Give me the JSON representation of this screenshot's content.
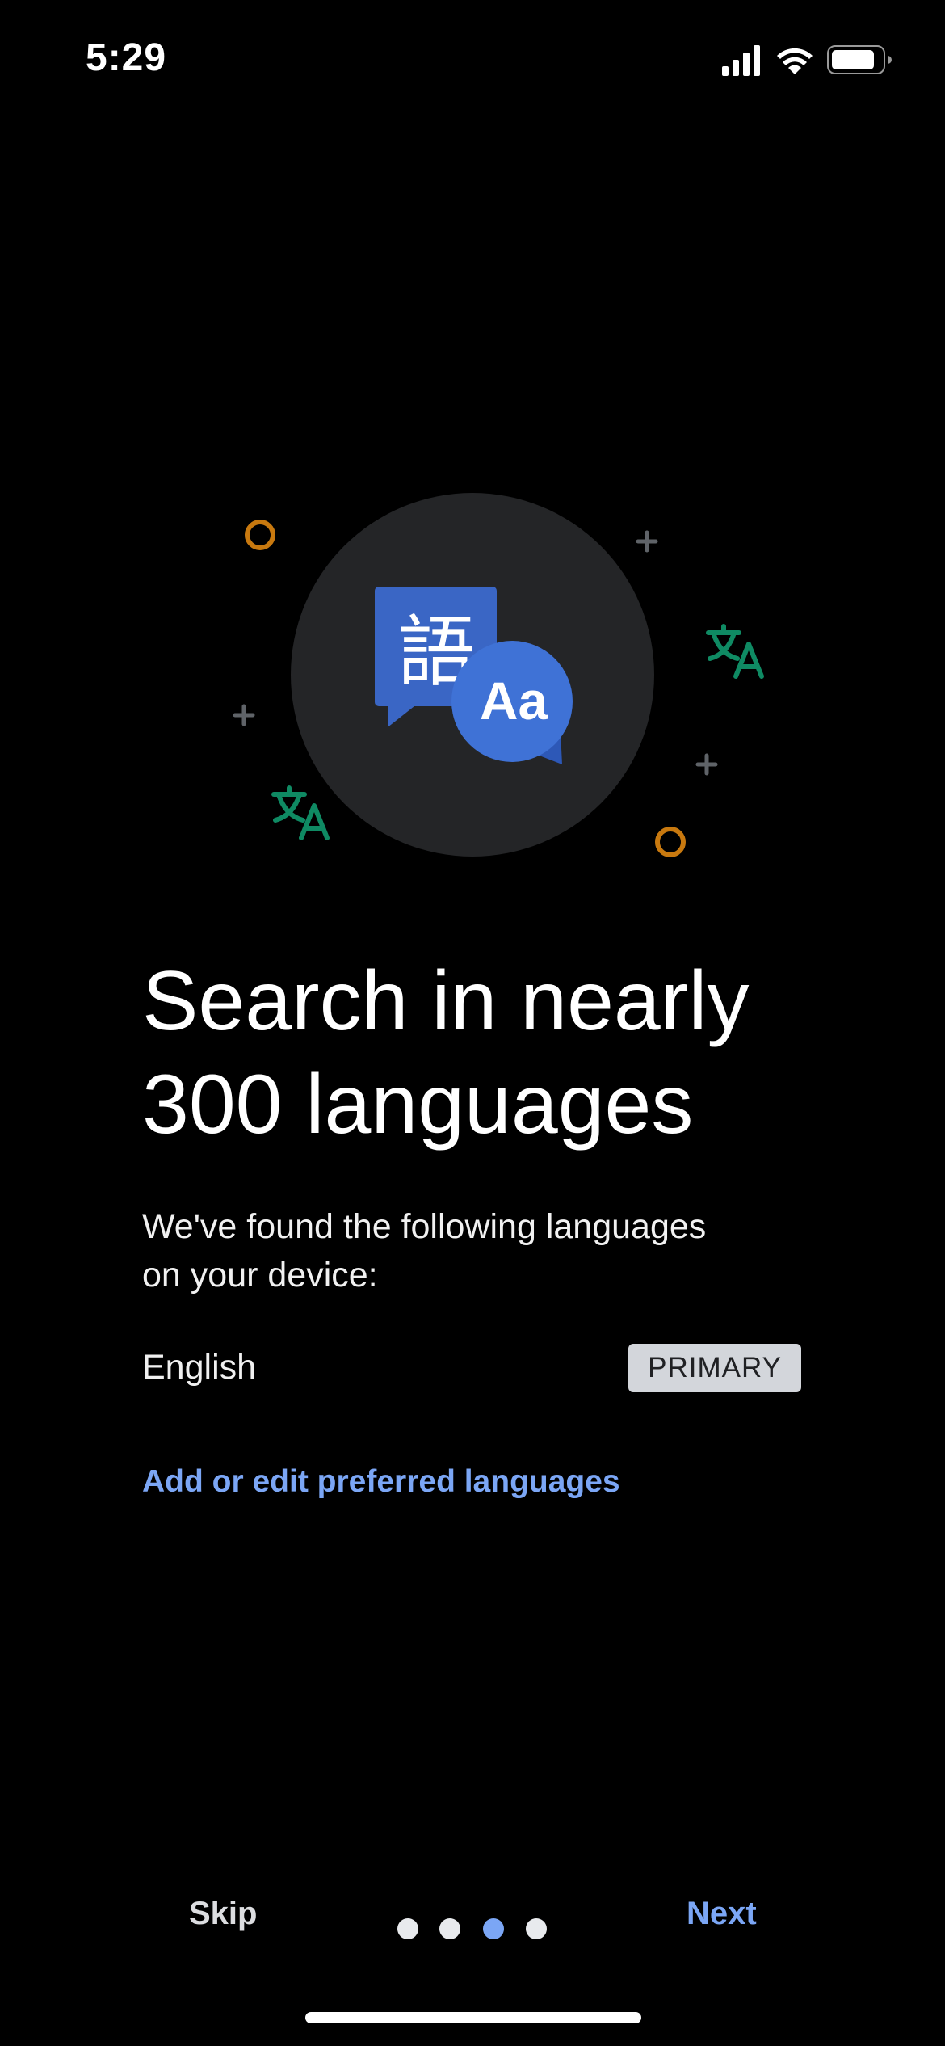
{
  "status_bar": {
    "time": "5:29"
  },
  "illustration": {
    "kanji": "語",
    "latin": "Aa",
    "colors": {
      "circle_bg": "#242527",
      "left_bubble": "#3a66c5",
      "right_bubble": "#3f72d6",
      "orange_ring": "#c8790f",
      "green_translate": "#0f8a63",
      "plus_gray": "#5f6368"
    }
  },
  "content": {
    "headline_line1": "Search in nearly",
    "headline_line2": "300 languages",
    "subtitle_line1": "We've found the following languages",
    "subtitle_line2": "on your device:",
    "language": "English",
    "badge": "PRIMARY",
    "edit_link": "Add or edit preferred languages"
  },
  "navigation": {
    "skip_label": "Skip",
    "next_label": "Next",
    "page_count": 4,
    "active_page": 3
  },
  "colors": {
    "accent": "#7ba6f5",
    "background": "#000000"
  }
}
